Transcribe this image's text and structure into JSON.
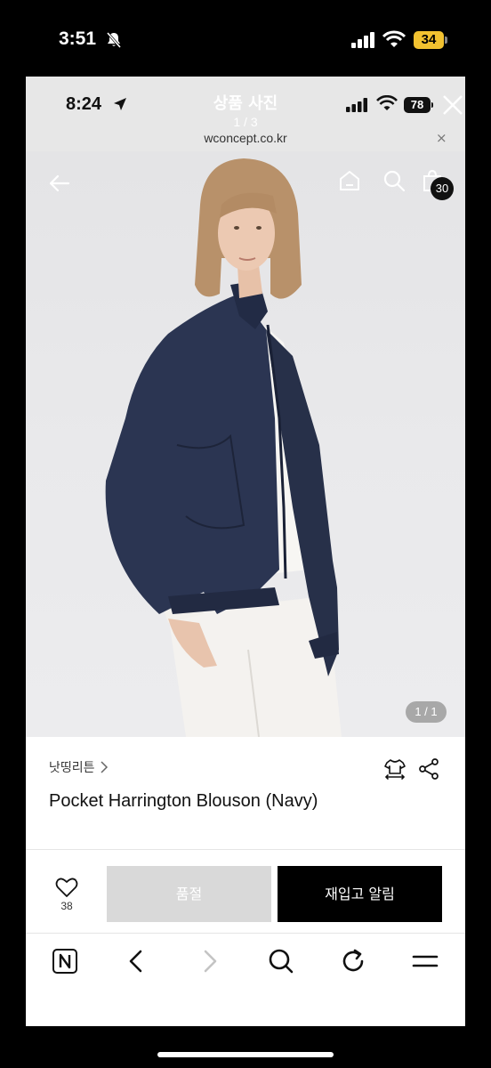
{
  "outer_status": {
    "time": "3:51",
    "battery": "34",
    "battery_color": "#f2c230"
  },
  "inner_status": {
    "time": "8:24",
    "battery": "78"
  },
  "viewer": {
    "title": "상품 사진",
    "counter": "1 / 3",
    "url": "wconcept.co.kr",
    "url_close": "×"
  },
  "hero": {
    "cart_count": "30",
    "pager": "1 / 1"
  },
  "product": {
    "brand": "낫띵리튼",
    "name": "Pocket Harrington Blouson (Navy)"
  },
  "actions": {
    "wish_count": "38",
    "soldout_label": "품절",
    "restock_label": "재입고 알림"
  },
  "toolbar": {
    "items": [
      "n-icon",
      "back-icon",
      "forward-icon",
      "search-icon",
      "refresh-icon",
      "menu-icon"
    ]
  },
  "colors": {
    "jacket": "#2b3552",
    "button_primary": "#000000",
    "button_disabled": "#d9d9d9"
  }
}
